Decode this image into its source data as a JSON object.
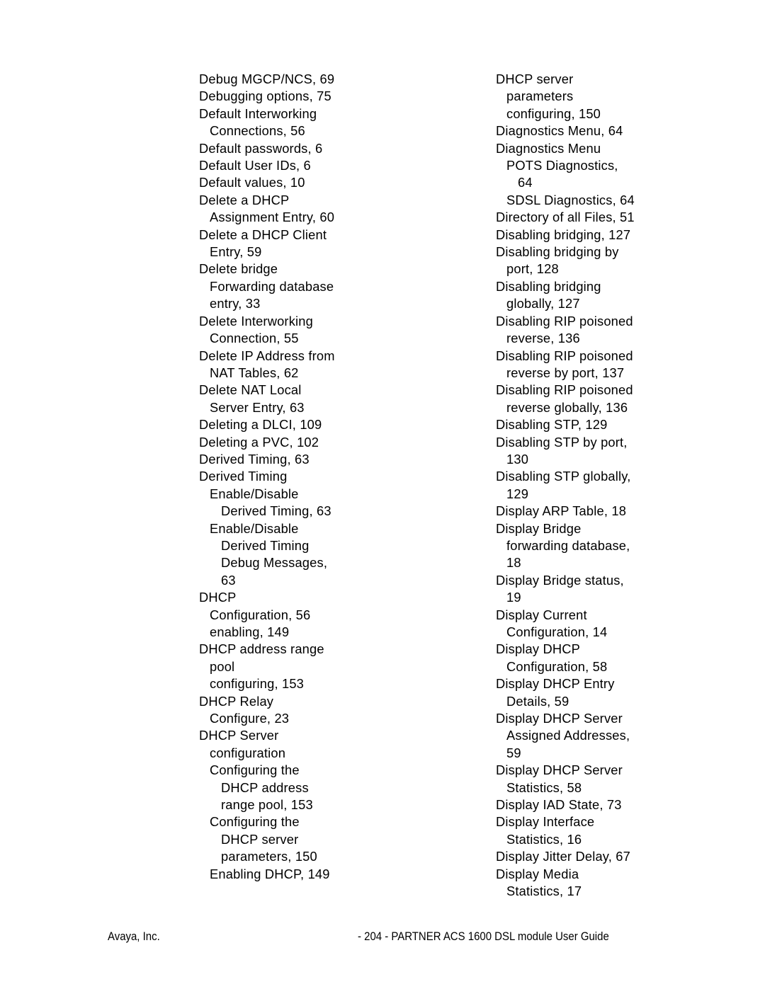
{
  "document": {
    "type": "index-page",
    "page_number": "204",
    "background_color": "#ffffff",
    "text_color": "#000000"
  },
  "index": {
    "left_column": [
      {
        "text": "Debug MGCP/NCS, 69",
        "level": 0
      },
      {
        "text": "Debugging options, 75",
        "level": 0
      },
      {
        "text": "Default Interworking",
        "level": 0
      },
      {
        "text": "Connections, 56",
        "level": 1
      },
      {
        "text": "Default passwords, 6",
        "level": 0
      },
      {
        "text": "Default User IDs, 6",
        "level": 0
      },
      {
        "text": "Default values, 10",
        "level": 0
      },
      {
        "text": "Delete a DHCP",
        "level": 0
      },
      {
        "text": "Assignment Entry, 60",
        "level": 1
      },
      {
        "text": "Delete a DHCP Client",
        "level": 0
      },
      {
        "text": "Entry, 59",
        "level": 1
      },
      {
        "text": "Delete bridge",
        "level": 0
      },
      {
        "text": "Forwarding database",
        "level": 1
      },
      {
        "text": "entry, 33",
        "level": 1
      },
      {
        "text": "Delete Interworking",
        "level": 0
      },
      {
        "text": "Connection, 55",
        "level": 1
      },
      {
        "text": "Delete IP Address from",
        "level": 0
      },
      {
        "text": "NAT Tables, 62",
        "level": 1
      },
      {
        "text": "Delete NAT Local",
        "level": 0
      },
      {
        "text": "Server Entry, 63",
        "level": 1
      },
      {
        "text": "Deleting a DLCI, 109",
        "level": 0
      },
      {
        "text": "Deleting a PVC, 102",
        "level": 0
      },
      {
        "text": "Derived Timing, 63",
        "level": 0
      },
      {
        "text": "Derived Timing",
        "level": 0
      },
      {
        "text": "Enable/Disable",
        "level": 1
      },
      {
        "text": "Derived Timing, 63",
        "level": 2
      },
      {
        "text": "Enable/Disable",
        "level": 1
      },
      {
        "text": "Derived Timing",
        "level": 2
      },
      {
        "text": "Debug Messages,",
        "level": 2
      },
      {
        "text": "63",
        "level": 2
      },
      {
        "text": "DHCP",
        "level": 0
      },
      {
        "text": "Configuration, 56",
        "level": 1
      },
      {
        "text": "enabling, 149",
        "level": 1
      },
      {
        "text": "DHCP address range",
        "level": 0
      },
      {
        "text": "pool",
        "level": 1
      },
      {
        "text": "configuring, 153",
        "level": 1
      },
      {
        "text": "DHCP Relay",
        "level": 0
      },
      {
        "text": "Configure, 23",
        "level": 1
      },
      {
        "text": "DHCP Server",
        "level": 0
      },
      {
        "text": "configuration",
        "level": 1
      },
      {
        "text": "Configuring the",
        "level": 1
      },
      {
        "text": "DHCP address",
        "level": 2
      },
      {
        "text": "range pool, 153",
        "level": 2
      },
      {
        "text": "Configuring the",
        "level": 1
      },
      {
        "text": "DHCP server",
        "level": 2
      },
      {
        "text": "parameters, 150",
        "level": 2
      },
      {
        "text": "Enabling DHCP, 149",
        "level": 1
      }
    ],
    "right_column": [
      {
        "text": "DHCP server",
        "level": 0
      },
      {
        "text": "parameters",
        "level": 1
      },
      {
        "text": "configuring, 150",
        "level": 1
      },
      {
        "text": "Diagnostics Menu, 64",
        "level": 0
      },
      {
        "text": "Diagnostics Menu",
        "level": 0
      },
      {
        "text": "POTS Diagnostics,",
        "level": 1
      },
      {
        "text": "64",
        "level": 2
      },
      {
        "text": "SDSL Diagnostics, 64",
        "level": 1
      },
      {
        "text": "Directory of all Files, 51",
        "level": 0
      },
      {
        "text": "Disabling bridging, 127",
        "level": 0
      },
      {
        "text": "Disabling bridging by",
        "level": 0
      },
      {
        "text": "port, 128",
        "level": 1
      },
      {
        "text": "Disabling bridging",
        "level": 0
      },
      {
        "text": "globally, 127",
        "level": 1
      },
      {
        "text": "Disabling RIP poisoned",
        "level": 0
      },
      {
        "text": "reverse, 136",
        "level": 1
      },
      {
        "text": "Disabling RIP poisoned",
        "level": 0
      },
      {
        "text": "reverse by port, 137",
        "level": 1
      },
      {
        "text": "Disabling RIP poisoned",
        "level": 0
      },
      {
        "text": "reverse globally, 136",
        "level": 1
      },
      {
        "text": "Disabling STP, 129",
        "level": 0
      },
      {
        "text": "Disabling STP by port,",
        "level": 0
      },
      {
        "text": "130",
        "level": 1
      },
      {
        "text": "Disabling STP globally,",
        "level": 0
      },
      {
        "text": "129",
        "level": 1
      },
      {
        "text": "Display ARP Table, 18",
        "level": 0
      },
      {
        "text": "Display Bridge",
        "level": 0
      },
      {
        "text": "forwarding database,",
        "level": 1
      },
      {
        "text": "18",
        "level": 1
      },
      {
        "text": "Display Bridge status,",
        "level": 0
      },
      {
        "text": "19",
        "level": 1
      },
      {
        "text": "Display Current",
        "level": 0
      },
      {
        "text": "Configuration, 14",
        "level": 1
      },
      {
        "text": "Display DHCP",
        "level": 0
      },
      {
        "text": "Configuration, 58",
        "level": 1
      },
      {
        "text": "Display DHCP Entry",
        "level": 0
      },
      {
        "text": "Details, 59",
        "level": 1
      },
      {
        "text": "Display DHCP Server",
        "level": 0
      },
      {
        "text": "Assigned Addresses,",
        "level": 1
      },
      {
        "text": "59",
        "level": 1
      },
      {
        "text": "Display DHCP Server",
        "level": 0
      },
      {
        "text": "Statistics, 58",
        "level": 1
      },
      {
        "text": "Display IAD State, 73",
        "level": 0
      },
      {
        "text": "Display Interface",
        "level": 0
      },
      {
        "text": "Statistics, 16",
        "level": 1
      },
      {
        "text": "Display Jitter Delay, 67",
        "level": 0
      },
      {
        "text": "Display Media",
        "level": 0
      },
      {
        "text": "Statistics, 17",
        "level": 1
      }
    ]
  },
  "footer": {
    "left": "Avaya, Inc.",
    "right": "- 204 - PARTNER ACS 1600 DSL module User Guide"
  }
}
